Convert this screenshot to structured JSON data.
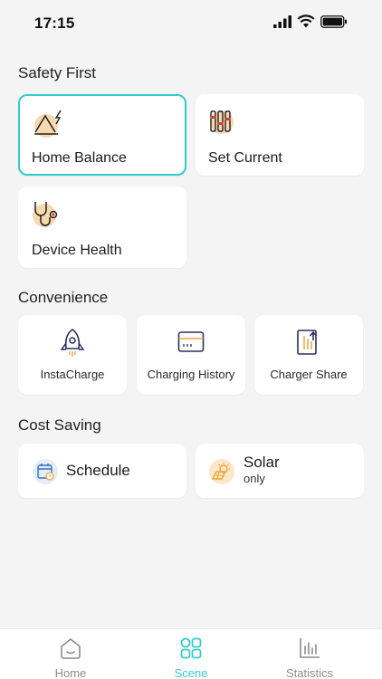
{
  "status_bar": {
    "time": "17:15"
  },
  "sections": {
    "safety": {
      "title": "Safety First",
      "cards": [
        {
          "label": "Home Balance",
          "icon": "home-balance-icon",
          "selected": true
        },
        {
          "label": "Set Current",
          "icon": "sliders-icon"
        },
        {
          "label": "Device Health",
          "icon": "stethoscope-icon"
        }
      ]
    },
    "convenience": {
      "title": "Convenience",
      "cards": [
        {
          "label": "InstaCharge",
          "icon": "rocket-icon"
        },
        {
          "label": "Charging History",
          "icon": "card-icon"
        },
        {
          "label": "Charger Share",
          "icon": "share-icon"
        }
      ]
    },
    "cost": {
      "title": "Cost Saving",
      "cards": [
        {
          "label": "Schedule",
          "icon": "calendar-icon"
        },
        {
          "label": "Solar",
          "sublabel": "only",
          "icon": "solar-icon"
        }
      ]
    }
  },
  "bottom_nav": {
    "items": [
      {
        "label": "Home",
        "icon": "home-icon"
      },
      {
        "label": "Scene",
        "icon": "scene-grid-icon",
        "active": true
      },
      {
        "label": "Statistics",
        "icon": "statistics-icon"
      }
    ]
  },
  "colors": {
    "accent": "#33cccc",
    "icon_bg": "#f7d9b0",
    "icon_bg_blue": "#e4eefa",
    "text": "#1c1c1c",
    "inactive": "#8c8c8c"
  }
}
